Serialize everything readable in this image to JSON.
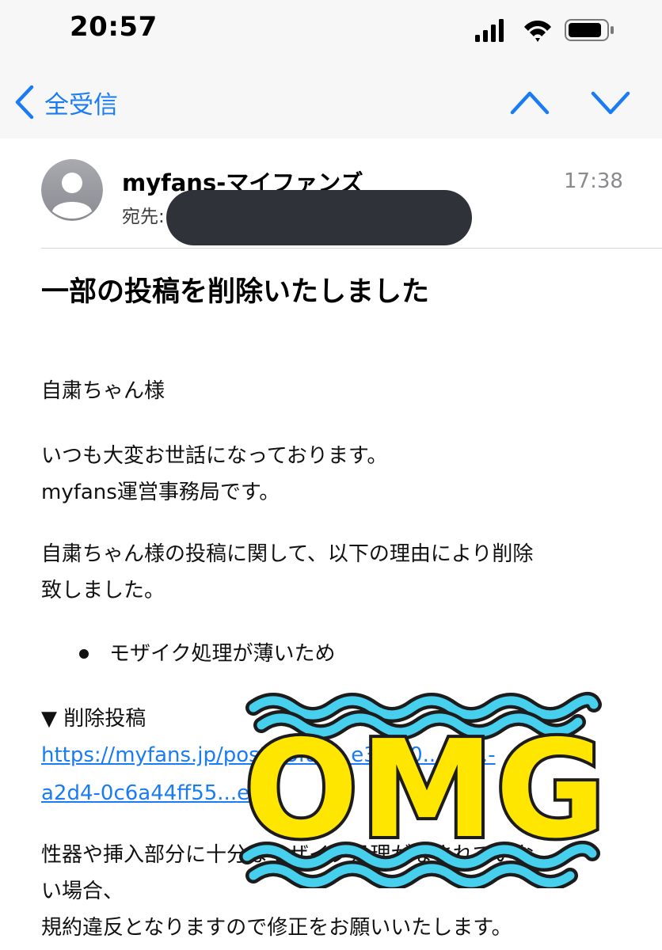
{
  "status_bar": {
    "time": "20:57"
  },
  "nav": {
    "back_label": "全受信"
  },
  "email": {
    "sender_name": "myfans-マイファンズ",
    "time": "17:38",
    "to_label": "宛先:",
    "subject": "一部の投稿を削除いたしました",
    "body": {
      "greeting": "自粛ちゃん様",
      "intro_1": "いつも大変お世話になっております。",
      "intro_2": "myfans運営事務局です。",
      "reason_1": "自粛ちゃん様の投稿に関して、以下の理由により削除",
      "reason_2": "致しました。",
      "bullet": "モザイク処理が薄いため",
      "deleted_heading": "▼ 削除投稿",
      "link_1": "https://myfans.jp/posts/3fa4...e3...60...40...-",
      "link_2": "a2d4-0c6a44ff55...e",
      "closing_1": "性器や挿入部分に十分なモザイク処理がなされていな",
      "closing_2": "い場合、",
      "closing_3": "規約違反となりますので修正をお願いいたします。"
    }
  },
  "sticker": {
    "text": "OMG"
  },
  "colors": {
    "accent": "#1a7cf5",
    "sticker_wave": "#46d0ee",
    "sticker_fill": "#ffe600",
    "redaction": "#2f3339"
  }
}
